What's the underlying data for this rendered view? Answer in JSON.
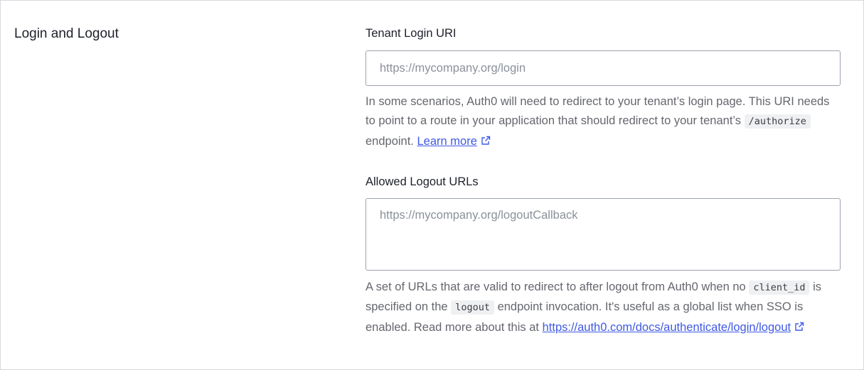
{
  "section": {
    "title": "Login and Logout"
  },
  "login_uri": {
    "label": "Tenant Login URI",
    "placeholder": "https://mycompany.org/login",
    "value": "",
    "help_part1": "In some scenarios, Auth0 will need to redirect to your tenant’s login page. This URI needs to point to a route in your application that should redirect to your tenant’s",
    "help_code": "/authorize",
    "help_part2": "endpoint.",
    "link_text": "Learn more",
    "link_icon": "external-link-icon"
  },
  "logout_urls": {
    "label": "Allowed Logout URLs",
    "placeholder": "https://mycompany.org/logoutCallback",
    "value": "",
    "help_part1": "A set of URLs that are valid to redirect to after logout from Auth0 when no",
    "help_code1": "client_id",
    "help_part2": "is specified on the",
    "help_code2": "logout",
    "help_part3": "endpoint invocation. It's useful as a global list when SSO is enabled. Read more about this at",
    "link_text": "https://auth0.com/docs/authenticate/login/logout",
    "link_icon": "external-link-icon"
  },
  "colors": {
    "link": "#3f59e4",
    "text": "#1e212a",
    "muted": "#65676e",
    "border": "#9ca2ad"
  }
}
